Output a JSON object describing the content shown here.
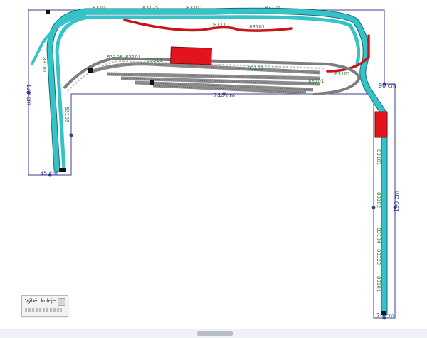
{
  "app": {
    "panel_title": "Výběr koleje"
  },
  "colors": {
    "track": "#35c2c8",
    "track_dark": "#1b6f74",
    "selected": "#c8161d",
    "siding": "#8c8c8c",
    "outline": "#3b3f8f",
    "building": "#e3141d"
  },
  "dimensions": {
    "width_top": "35 cm",
    "width_bottom": "20 cm",
    "length_left": "130 cm",
    "length_middle": "244 cm",
    "length_right": "190 cm",
    "length_corner": "90 cm"
  },
  "track_codes": [
    "83101",
    "83104",
    "83105",
    "83106",
    "83111",
    "83122",
    "83125",
    "83301",
    "83306",
    "83311",
    "83322",
    "83102",
    "83103",
    "83108",
    "83100"
  ],
  "scrollbar": {
    "position": 0.49
  }
}
